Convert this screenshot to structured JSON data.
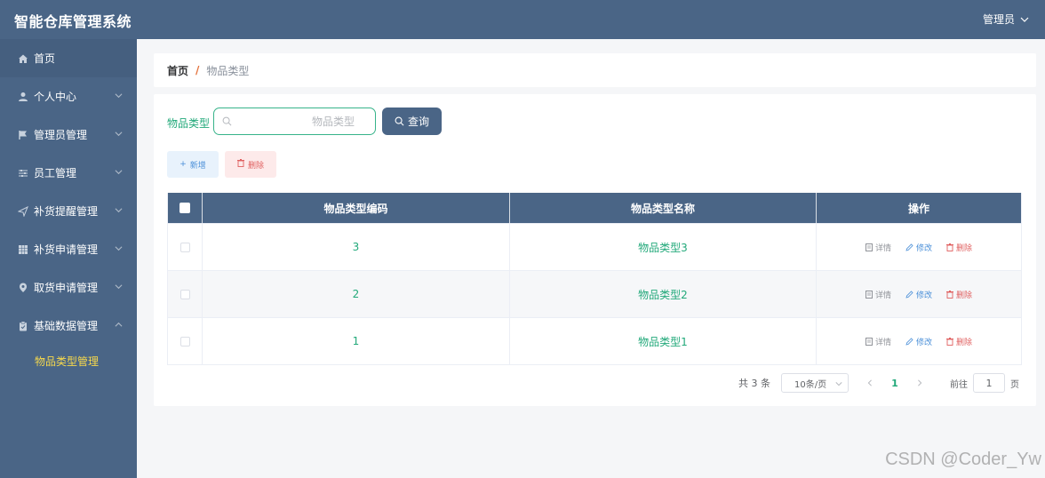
{
  "header": {
    "app_title": "智能仓库管理系统",
    "user_label": "管理员"
  },
  "sidebar": {
    "items": [
      {
        "label": "首页",
        "icon": "home-icon"
      },
      {
        "label": "个人中心",
        "icon": "user-icon"
      },
      {
        "label": "管理员管理",
        "icon": "flag-icon"
      },
      {
        "label": "员工管理",
        "icon": "sliders-icon"
      },
      {
        "label": "补货提醒管理",
        "icon": "send-icon"
      },
      {
        "label": "补货申请管理",
        "icon": "grid-icon"
      },
      {
        "label": "取货申请管理",
        "icon": "location-icon"
      },
      {
        "label": "基础数据管理",
        "icon": "clipboard-icon"
      }
    ],
    "sub_items": [
      {
        "label": "物品类型管理"
      }
    ]
  },
  "breadcrumb": {
    "home": "首页",
    "separator": "/",
    "current": "物品类型"
  },
  "search": {
    "label": "物品类型",
    "placeholder": "物品类型",
    "value": "",
    "button_label": "查询"
  },
  "actions": {
    "add_label": "新增",
    "delete_label": "删除"
  },
  "table": {
    "columns": [
      "物品类型编码",
      "物品类型名称",
      "操作"
    ],
    "rows": [
      {
        "code": "3",
        "name": "物品类型3"
      },
      {
        "code": "2",
        "name": "物品类型2"
      },
      {
        "code": "1",
        "name": "物品类型1"
      }
    ],
    "row_ops": {
      "detail": "详情",
      "edit": "修改",
      "delete": "删除"
    }
  },
  "pagination": {
    "total_text": "共 3 条",
    "page_size": "10条/页",
    "current_page": "1",
    "goto_label": "前往",
    "goto_value": "1",
    "unit": "页"
  },
  "watermark": "CSDN @Coder_Yw",
  "colors": {
    "primary": "#4a6586",
    "accent": "#22a97a",
    "highlight": "#f7d94c",
    "danger": "#e06060",
    "link": "#4a8fd8"
  }
}
